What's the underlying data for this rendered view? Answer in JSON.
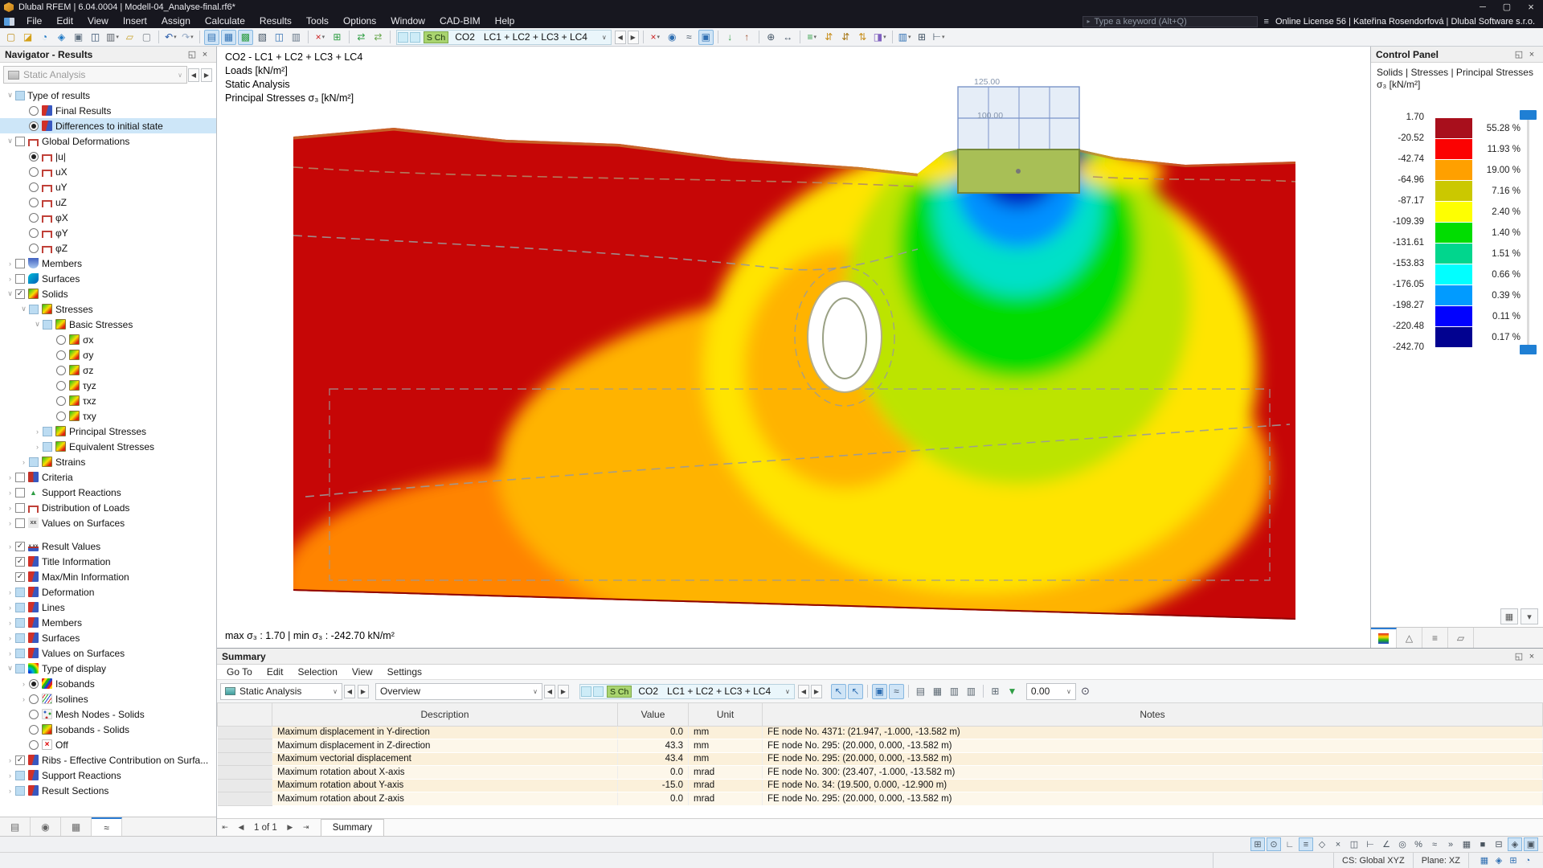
{
  "window": {
    "title": "Dlubal RFEM | 6.04.0004 | Modell-04_Analyse-final.rf6*"
  },
  "icons": {
    "minimize": "─",
    "maximize": "▢",
    "close": "×",
    "float": "◱",
    "prev": "◀",
    "next": "▶",
    "caret": "▾",
    "search_menu": "≡",
    "run_tri": "▸",
    "search_round": "⊙"
  },
  "menu": {
    "items": [
      "File",
      "Edit",
      "View",
      "Insert",
      "Assign",
      "Calculate",
      "Results",
      "Tools",
      "Options",
      "Window",
      "CAD-BIM",
      "Help"
    ],
    "search_placeholder": "Type a keyword (Alt+Q)",
    "license": "Online License 56 | Kateřina Rosendorfová | Dlubal Software s.r.o."
  },
  "toolbar": {
    "groups_left": [
      [
        {
          "n": "new-model",
          "g": "▢",
          "c": "#c09020"
        },
        {
          "n": "open-model",
          "g": "◪",
          "c": "#d4a017"
        },
        {
          "n": "dlubal-cloud",
          "g": "◔",
          "c": "#1a76c4"
        },
        {
          "n": "model-cube",
          "g": "◈",
          "c": "#1a76c4"
        },
        {
          "n": "screen-capture",
          "g": "▣",
          "c": "#607080"
        },
        {
          "n": "save",
          "g": "◫",
          "c": "#35506e"
        },
        {
          "n": "print",
          "g": "▥",
          "c": "#5a6068",
          "k": 1
        },
        {
          "n": "edit-document",
          "g": "▱",
          "c": "#c8a22a"
        },
        {
          "n": "report",
          "g": "▢",
          "c": "#7c848c"
        }
      ],
      [
        {
          "n": "undo",
          "g": "↶",
          "c": "#2458a8",
          "k": 1
        },
        {
          "n": "redo",
          "g": "↷",
          "c": "#94a8c4",
          "k": 1
        }
      ],
      [
        {
          "n": "tables-data",
          "g": "▤",
          "c": "#2f6fb2",
          "p": 1
        },
        {
          "n": "tables-grid",
          "g": "▦",
          "c": "#2f6fb2",
          "p": 1
        },
        {
          "n": "tables-results",
          "g": "▩",
          "c": "#2f9e44",
          "p": 1
        },
        {
          "n": "console-sc",
          "g": "▧",
          "c": "#445566"
        },
        {
          "n": "new-window",
          "g": "◫",
          "c": "#2f6fb2"
        },
        {
          "n": "protocol",
          "g": "▥",
          "c": "#667788"
        }
      ],
      [
        {
          "n": "delete-results",
          "g": "×",
          "c": "#cc2020",
          "k": 1
        },
        {
          "n": "add-table",
          "g": "⊞",
          "c": "#2f9e44"
        }
      ],
      [
        {
          "n": "link-model",
          "g": "⇄",
          "c": "#2f9e44"
        },
        {
          "n": "update-link",
          "g": "⇄",
          "c": "#6aa84f"
        }
      ]
    ],
    "loadcase": {
      "badge": "S Ch",
      "name": "CO2",
      "combination": "LC1 + LC2 + LC3 + LC4"
    },
    "groups_right": [
      [
        {
          "n": "filter-results",
          "g": "×",
          "c": "#cc2020",
          "k": 1
        },
        {
          "n": "show-values",
          "g": "◉",
          "c": "#2f6fb2"
        },
        {
          "n": "result-values-xxx",
          "g": "≈",
          "c": "#445566"
        },
        {
          "n": "display-results",
          "g": "▣",
          "c": "#2f6fb2",
          "p": 1
        }
      ],
      [
        {
          "n": "load-transfer",
          "g": "↓",
          "c": "#2f9e44"
        },
        {
          "n": "export-results",
          "g": "↑",
          "c": "#a05030"
        }
      ],
      [
        {
          "n": "zoom-in",
          "g": "⊕",
          "c": "#445566"
        },
        {
          "n": "pan-view",
          "g": "↔",
          "c": "#445566"
        }
      ],
      [
        {
          "n": "display-properties",
          "g": "≡",
          "c": "#2f9e44",
          "k": 1
        },
        {
          "n": "sort-ascending",
          "g": "⇵",
          "c": "#c89020"
        },
        {
          "n": "sort-descending",
          "g": "⇵",
          "c": "#a87818"
        },
        {
          "n": "filter-sort",
          "g": "⇅",
          "c": "#c89020"
        },
        {
          "n": "paint-display",
          "g": "◨",
          "c": "#8060c0",
          "k": 1
        }
      ],
      [
        {
          "n": "panels",
          "g": "▥",
          "c": "#2f6fb2",
          "k": 1
        },
        {
          "n": "grid",
          "g": "⊞",
          "c": "#445566"
        },
        {
          "n": "measure",
          "g": "⊢",
          "c": "#445566",
          "k": 1
        }
      ]
    ]
  },
  "navigator": {
    "title": "Navigator - Results",
    "analysis_combo": "Static Analysis",
    "tree": [
      {
        "l": "Type of results",
        "v": 0,
        "e": "v",
        "c": "cbp"
      },
      {
        "l": "Final Results",
        "v": 1,
        "c": "rb",
        "i": "i-result"
      },
      {
        "l": "Differences to initial state",
        "v": 1,
        "c": "rb1",
        "i": "i-result",
        "s": 1
      },
      {
        "l": "Global Deformations",
        "v": 0,
        "e": "v",
        "c": "cb",
        "i": "i-frame"
      },
      {
        "l": "|u|",
        "v": 1,
        "c": "rb1",
        "i": "i-frame"
      },
      {
        "l": "uX",
        "v": 1,
        "c": "rb",
        "i": "i-frame"
      },
      {
        "l": "uY",
        "v": 1,
        "c": "rb",
        "i": "i-frame"
      },
      {
        "l": "uZ",
        "v": 1,
        "c": "rb",
        "i": "i-frame"
      },
      {
        "l": "φX",
        "v": 1,
        "c": "rb",
        "i": "i-frame"
      },
      {
        "l": "φY",
        "v": 1,
        "c": "rb",
        "i": "i-frame"
      },
      {
        "l": "φZ",
        "v": 1,
        "c": "rb",
        "i": "i-frame"
      },
      {
        "l": "Members",
        "v": 0,
        "e": ">",
        "c": "cb",
        "i": "i-member"
      },
      {
        "l": "Surfaces",
        "v": 0,
        "e": ">",
        "c": "cb",
        "i": "i-surface"
      },
      {
        "l": "Solids",
        "v": 0,
        "e": "v",
        "c": "cb1",
        "i": "i-cube"
      },
      {
        "l": "Stresses",
        "v": 1,
        "e": "v",
        "c": "cbp",
        "i": "i-cube"
      },
      {
        "l": "Basic Stresses",
        "v": 2,
        "e": "v",
        "c": "cbp",
        "i": "i-cube"
      },
      {
        "l": "σx",
        "v": 3,
        "c": "rb",
        "i": "i-cube"
      },
      {
        "l": "σy",
        "v": 3,
        "c": "rb",
        "i": "i-cube"
      },
      {
        "l": "σz",
        "v": 3,
        "c": "rb",
        "i": "i-cube"
      },
      {
        "l": "τyz",
        "v": 3,
        "c": "rb",
        "i": "i-cube"
      },
      {
        "l": "τxz",
        "v": 3,
        "c": "rb",
        "i": "i-cube"
      },
      {
        "l": "τxy",
        "v": 3,
        "c": "rb",
        "i": "i-cube"
      },
      {
        "l": "Principal Stresses",
        "v": 2,
        "e": ">",
        "c": "cbp",
        "i": "i-cube"
      },
      {
        "l": "Equivalent Stresses",
        "v": 2,
        "e": ">",
        "c": "cbp",
        "i": "i-cube"
      },
      {
        "l": "Strains",
        "v": 1,
        "e": ">",
        "c": "cbp",
        "i": "i-cube"
      },
      {
        "l": "Criteria",
        "v": 0,
        "e": ">",
        "c": "cb",
        "i": "i-criteria"
      },
      {
        "l": "Support Reactions",
        "v": 0,
        "e": ">",
        "c": "cb",
        "i": "i-support"
      },
      {
        "l": "Distribution of Loads",
        "v": 0,
        "e": ">",
        "c": "cb",
        "i": "i-frame"
      },
      {
        "l": "Values on Surfaces",
        "v": 0,
        "e": ">",
        "c": "cb",
        "i": "i-values"
      },
      {
        "l": "Result Values",
        "v": 0,
        "e": ">",
        "c": "cb1",
        "i": "i-xxx",
        "g": 1
      },
      {
        "l": "Title Information",
        "v": 0,
        "c": "cb1",
        "i": "i-result"
      },
      {
        "l": "Max/Min Information",
        "v": 0,
        "c": "cb1",
        "i": "i-result"
      },
      {
        "l": "Deformation",
        "v": 0,
        "e": ">",
        "c": "cbp",
        "i": "i-result"
      },
      {
        "l": "Lines",
        "v": 0,
        "e": ">",
        "c": "cbp",
        "i": "i-result"
      },
      {
        "l": "Members",
        "v": 0,
        "e": ">",
        "c": "cbp",
        "i": "i-result"
      },
      {
        "l": "Surfaces",
        "v": 0,
        "e": ">",
        "c": "cbp",
        "i": "i-result"
      },
      {
        "l": "Values on Surfaces",
        "v": 0,
        "e": ">",
        "c": "cbp",
        "i": "i-result"
      },
      {
        "l": "Type of display",
        "v": 0,
        "e": "v",
        "c": "cbp",
        "i": "i-rainbow"
      },
      {
        "l": "Isobands",
        "v": 1,
        "e": ">",
        "c": "rb1",
        "i": "i-isoband"
      },
      {
        "l": "Isolines",
        "v": 1,
        "e": ">",
        "c": "rb",
        "i": "i-isoline"
      },
      {
        "l": "Mesh Nodes - Solids",
        "v": 1,
        "c": "rb",
        "i": "i-mesh"
      },
      {
        "l": "Isobands - Solids",
        "v": 1,
        "c": "rb",
        "i": "i-cube"
      },
      {
        "l": "Off",
        "v": 1,
        "c": "rb",
        "i": "i-off"
      },
      {
        "l": "Ribs - Effective Contribution on Surfa...",
        "v": 0,
        "e": ">",
        "c": "cb1",
        "i": "i-result"
      },
      {
        "l": "Support Reactions",
        "v": 0,
        "e": ">",
        "c": "cbp",
        "i": "i-result"
      },
      {
        "l": "Result Sections",
        "v": 0,
        "e": ">",
        "c": "cbp",
        "i": "i-result"
      }
    ],
    "tabs": [
      {
        "n": "nav-tab-data",
        "g": "▤"
      },
      {
        "n": "nav-tab-display",
        "g": "◉"
      },
      {
        "n": "nav-tab-views",
        "g": "▦"
      },
      {
        "n": "nav-tab-results",
        "g": "≈",
        "active": 1
      }
    ]
  },
  "viewport": {
    "header_lines": [
      "CO2 - LC1 + LC2 + LC3 + LC4",
      "Loads [kN/m²]",
      "Static Analysis",
      "Principal Stresses σ₃ [kN/m²]"
    ],
    "maxmin": "max σ₃ : 1.70 | min σ₃ : -242.70 kN/m²",
    "dim_labels": {
      "top": "125.00",
      "mid": "100.00"
    }
  },
  "control_panel": {
    "title": "Control Panel",
    "subtitle_line1": "Solids | Stresses | Principal Stresses",
    "subtitle_line2": "σ₃ [kN/m²]",
    "legend": {
      "values": [
        "1.70",
        "-20.52",
        "-42.74",
        "-64.96",
        "-87.17",
        "-109.39",
        "-131.61",
        "-153.83",
        "-176.05",
        "-198.27",
        "-220.48",
        "-242.70"
      ],
      "bands": [
        {
          "color": "#a80f1c",
          "pct": "55.28 %"
        },
        {
          "color": "#fb0202",
          "pct": "11.93 %"
        },
        {
          "color": "#ffa000",
          "pct": "19.00 %"
        },
        {
          "color": "#cbc800",
          "pct": "7.16 %"
        },
        {
          "color": "#feff01",
          "pct": "2.40 %"
        },
        {
          "color": "#01dd01",
          "pct": "1.40 %"
        },
        {
          "color": "#01d68d",
          "pct": "1.51 %"
        },
        {
          "color": "#01ffff",
          "pct": "0.66 %"
        },
        {
          "color": "#019bff",
          "pct": "0.39 %"
        },
        {
          "color": "#0202fe",
          "pct": "0.11 %"
        },
        {
          "color": "#020290",
          "pct": "0.17 %"
        }
      ]
    },
    "tabs": [
      {
        "n": "cp-tab-color-scale",
        "g": "sw",
        "active": 1
      },
      {
        "n": "cp-tab-factors",
        "g": "△"
      },
      {
        "n": "cp-tab-filter",
        "g": "≡"
      },
      {
        "n": "cp-tab-settings",
        "g": "▱"
      }
    ]
  },
  "summary": {
    "title": "Summary",
    "menu": [
      "Go To",
      "Edit",
      "Selection",
      "View",
      "Settings"
    ],
    "analysis_combo": "Static Analysis",
    "view_combo": "Overview",
    "loadcase": {
      "badge": "S Ch",
      "name": "CO2",
      "combination": "LC1 + LC2 + LC3 + LC4"
    },
    "cluster": [
      {
        "n": "select-cursor",
        "g": "↖",
        "c": "#2f6fb2",
        "p": 1
      },
      {
        "n": "select-window",
        "g": "↖",
        "c": "#2f6fb2",
        "p": 1
      },
      {
        "n": "sep"
      },
      {
        "n": "show-results-display",
        "g": "▣",
        "c": "#2f6fb2",
        "p": 1
      },
      {
        "n": "show-result-values",
        "g": "≈",
        "c": "#445566",
        "p": 1
      },
      {
        "n": "sep"
      },
      {
        "n": "table-view",
        "g": "▤",
        "c": "#5a6670"
      },
      {
        "n": "table-export",
        "g": "▦",
        "c": "#5a6670"
      },
      {
        "n": "table-layout",
        "g": "▥",
        "c": "#5a6670"
      },
      {
        "n": "print-table",
        "g": "▥",
        "c": "#5a6670"
      },
      {
        "n": "sep"
      },
      {
        "n": "grid-view",
        "g": "⊞",
        "c": "#5a6670"
      },
      {
        "n": "filter-green",
        "g": "▼",
        "c": "#2f9e44"
      }
    ],
    "smoothing_value": "0.00",
    "table": {
      "headers": [
        "Description",
        "Value",
        "Unit",
        "Notes"
      ],
      "rows": [
        [
          "Maximum displacement in Y-direction",
          "0.0",
          "mm",
          "FE node No. 4371: (21.947, -1.000, -13.582 m)"
        ],
        [
          "Maximum displacement in Z-direction",
          "43.3",
          "mm",
          "FE node No. 295: (20.000, 0.000, -13.582 m)"
        ],
        [
          "Maximum vectorial displacement",
          "43.4",
          "mm",
          "FE node No. 295: (20.000, 0.000, -13.582 m)"
        ],
        [
          "Maximum rotation about X-axis",
          "0.0",
          "mrad",
          "FE node No. 300: (23.407, -1.000, -13.582 m)"
        ],
        [
          "Maximum rotation about Y-axis",
          "-15.0",
          "mrad",
          "FE node No. 34: (19.500, 0.000, -12.900 m)"
        ],
        [
          "Maximum rotation about Z-axis",
          "0.0",
          "mrad",
          "FE node No. 295: (20.000, 0.000, -13.582 m)"
        ]
      ]
    },
    "pager": "1 of 1",
    "tab": "Summary"
  },
  "statusbar": {
    "snap_icons": [
      {
        "n": "snap-grid",
        "g": "⊞",
        "p": 1
      },
      {
        "n": "snap-points",
        "g": "⊙",
        "p": 1
      },
      {
        "n": "snap-ortho",
        "g": "∟"
      },
      {
        "n": "snap-guides",
        "g": "≡",
        "p": 1
      },
      {
        "n": "snap-object",
        "g": "◇"
      },
      {
        "n": "snap-intersection",
        "g": "×"
      },
      {
        "n": "snap-midpoint",
        "g": "◫"
      },
      {
        "n": "snap-perpendicular",
        "g": "⊢"
      },
      {
        "n": "snap-angle",
        "g": "∠"
      },
      {
        "n": "snap-center",
        "g": "◎"
      },
      {
        "n": "snap-percent",
        "g": "%"
      },
      {
        "n": "snap-nearest",
        "g": "≈"
      },
      {
        "n": "snap-extension",
        "g": "»"
      },
      {
        "n": "snap-tangent",
        "g": "▦"
      },
      {
        "n": "snap-off",
        "g": "■"
      },
      {
        "n": "snap-lock",
        "g": "⊟"
      },
      {
        "n": "snap-3d",
        "g": "◈",
        "p": 1
      },
      {
        "n": "snap-work-plane",
        "g": "▣",
        "p": 1
      }
    ],
    "cs_label": "CS: Global XYZ",
    "plane_label": "Plane: XZ",
    "corner_icons": [
      {
        "n": "corner-tables",
        "g": "▦"
      },
      {
        "n": "corner-render",
        "g": "◈"
      },
      {
        "n": "corner-grid",
        "g": "⊞"
      },
      {
        "n": "corner-view",
        "g": "◔"
      }
    ]
  }
}
